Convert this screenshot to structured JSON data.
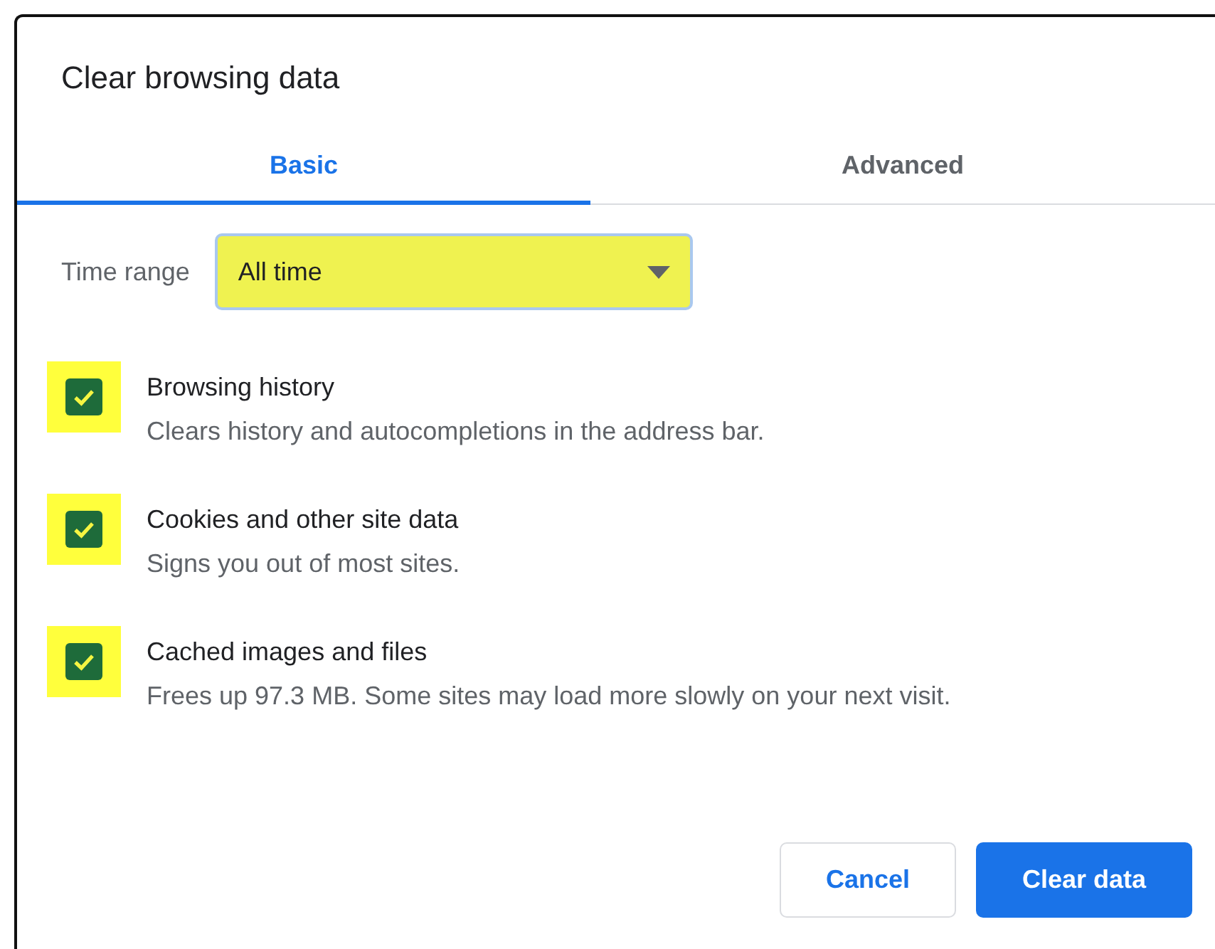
{
  "dialog": {
    "title": "Clear browsing data"
  },
  "tabs": [
    {
      "label": "Basic",
      "selected": true
    },
    {
      "label": "Advanced",
      "selected": false
    }
  ],
  "time_range": {
    "label": "Time range",
    "value": "All time"
  },
  "options": [
    {
      "title": "Browsing history",
      "description": "Clears history and autocompletions in the address bar.",
      "checked": true
    },
    {
      "title": "Cookies and other site data",
      "description": "Signs you out of most sites.",
      "checked": true
    },
    {
      "title": "Cached images and files",
      "description": "Frees up 97.3 MB. Some sites may load more slowly on your next visit.",
      "checked": true
    }
  ],
  "buttons": [
    {
      "label": "Cancel",
      "kind": "secondary"
    },
    {
      "label": "Clear data",
      "kind": "primary"
    }
  ]
}
